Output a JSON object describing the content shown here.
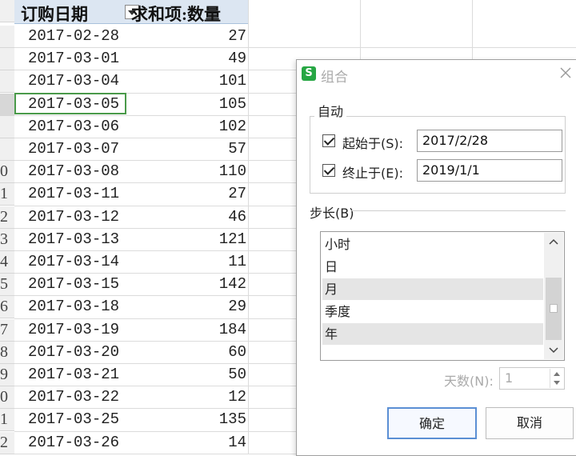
{
  "pivot": {
    "col_date": "订购日期",
    "col_sum": "求和项:数量",
    "rows": [
      {
        "date": "2017-02-28",
        "qty": "27"
      },
      {
        "date": "2017-03-01",
        "qty": "49"
      },
      {
        "date": "2017-03-04",
        "qty": "101"
      },
      {
        "date": "2017-03-05",
        "qty": "105"
      },
      {
        "date": "2017-03-06",
        "qty": "102"
      },
      {
        "date": "2017-03-07",
        "qty": "57"
      },
      {
        "date": "2017-03-08",
        "qty": "110"
      },
      {
        "date": "2017-03-11",
        "qty": "27"
      },
      {
        "date": "2017-03-12",
        "qty": "46"
      },
      {
        "date": "2017-03-13",
        "qty": "121"
      },
      {
        "date": "2017-03-14",
        "qty": "11"
      },
      {
        "date": "2017-03-15",
        "qty": "142"
      },
      {
        "date": "2017-03-18",
        "qty": "29"
      },
      {
        "date": "2017-03-19",
        "qty": "184"
      },
      {
        "date": "2017-03-20",
        "qty": "60"
      },
      {
        "date": "2017-03-21",
        "qty": "50"
      },
      {
        "date": "2017-03-22",
        "qty": "12"
      },
      {
        "date": "2017-03-25",
        "qty": "135"
      },
      {
        "date": "2017-03-26",
        "qty": "14"
      }
    ],
    "row_number_tails": [
      "",
      "",
      "",
      "",
      "",
      "",
      "",
      "0",
      "1",
      "2",
      "3",
      "4",
      "5",
      "6",
      "7",
      "8",
      "9",
      "0",
      "1",
      "2"
    ]
  },
  "dialog": {
    "icon_letter": "S",
    "title": "组合",
    "auto_label": "自动",
    "start_label": "起始于(S):",
    "start_value": "2017/2/28",
    "end_label": "终止于(E):",
    "end_value": "2019/1/1",
    "step_label": "步长(B)",
    "step_options": [
      {
        "label": "小时",
        "selected": false
      },
      {
        "label": "日",
        "selected": false
      },
      {
        "label": "月",
        "selected": true
      },
      {
        "label": "季度",
        "selected": false
      },
      {
        "label": "年",
        "selected": true
      }
    ],
    "days_label": "天数(N):",
    "days_value": "1",
    "ok_label": "确定",
    "cancel_label": "取消"
  },
  "colors": {
    "header_bg": "#dce6f2",
    "selected_cell_border": "#4a9a4a",
    "brand_icon": "#27a744",
    "primary_button_border": "#5b8fd4"
  }
}
